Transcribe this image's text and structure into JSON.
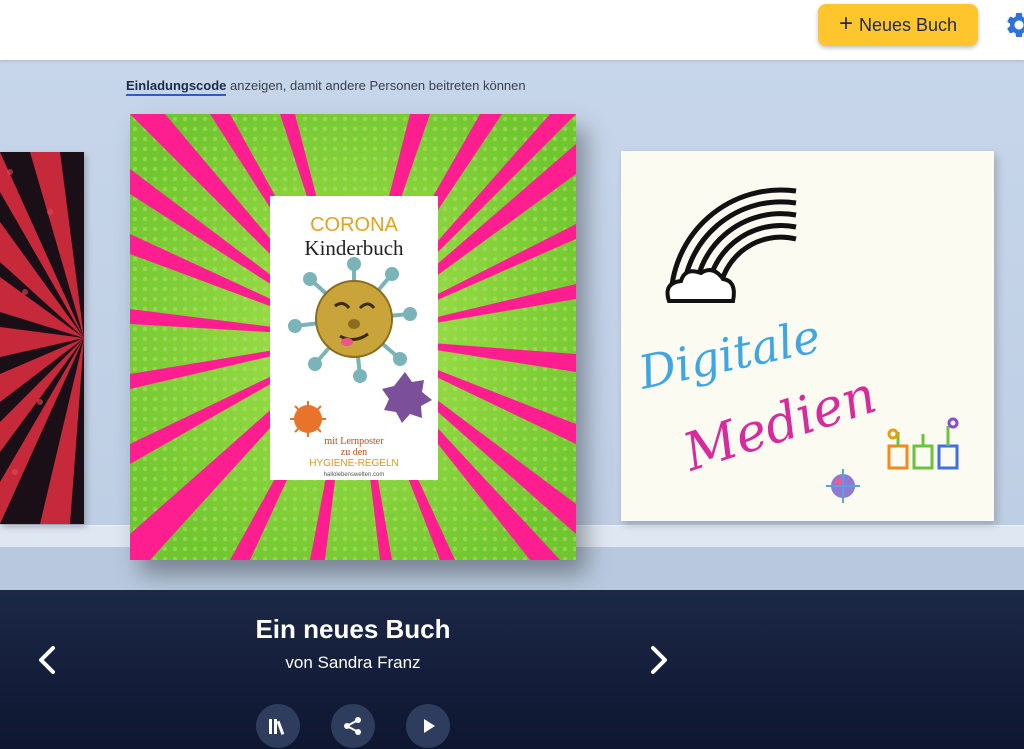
{
  "topbar": {
    "new_book_label": "Neues Buch",
    "new_book_icon": "plus-icon",
    "settings_icon": "gear-icon"
  },
  "invite": {
    "link_text": "Einladungscode",
    "rest_text": " anzeigen, damit andere Personen beitreten können"
  },
  "shelf": {
    "books": [
      {
        "position": "left",
        "cover_style": "red comic burst"
      },
      {
        "position": "center",
        "cover_title_line1": "CORONA",
        "cover_title_line2": "Kinderbuch",
        "cover_subtitle_line1": "mit Lernposter",
        "cover_subtitle_line2": "zu den",
        "cover_subtitle_line3": "HYGIENE-REGELN",
        "cover_footer": "hallolebenswelten.com"
      },
      {
        "position": "right",
        "cover_word1": "Digitale",
        "cover_word2": "Medien"
      }
    ]
  },
  "selected_book": {
    "title": "Ein neues Buch",
    "author": "von Sandra Franz"
  },
  "controls": {
    "prev_icon": "chevron-left-icon",
    "next_icon": "chevron-right-icon",
    "library_icon": "library-icon",
    "share_icon": "share-icon",
    "play_icon": "play-icon"
  },
  "colors": {
    "accent_button": "#ffc52d",
    "bottom_panel": "#1b2846",
    "shelf_background": "#c7d6ea",
    "link_underline": "#2b5fb8",
    "gear": "#2f73d9"
  }
}
